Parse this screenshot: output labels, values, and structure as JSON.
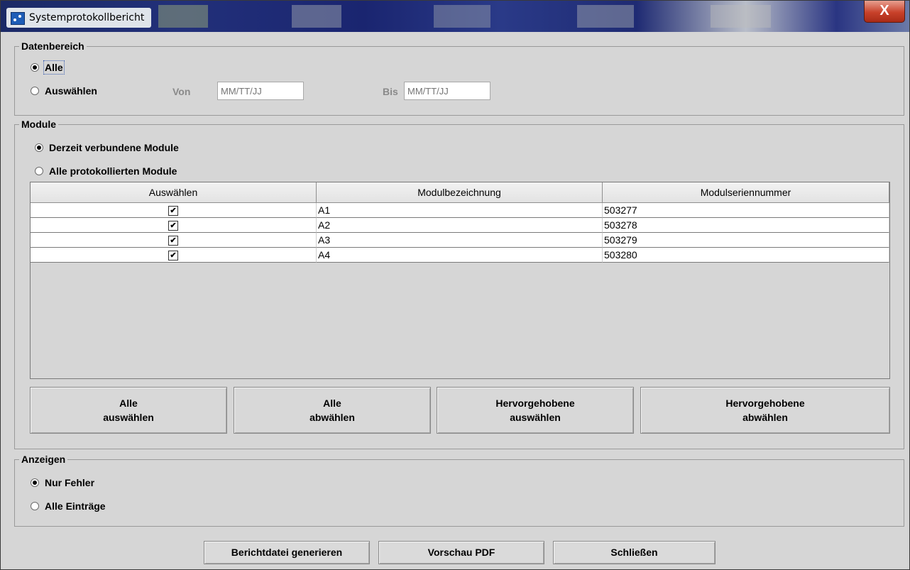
{
  "window": {
    "title": "Systemprotokollbericht",
    "close_glyph": "X"
  },
  "datenbereich": {
    "title": "Datenbereich",
    "options": [
      "Alle",
      "Auswählen"
    ],
    "selected": "Alle",
    "von_label": "Von",
    "von_placeholder": "MM/TT/JJ",
    "bis_label": "Bis",
    "bis_placeholder": "MM/TT/JJ"
  },
  "module": {
    "title": "Module",
    "options": [
      "Derzeit verbundene Module",
      "Alle protokollierten Module"
    ],
    "selected": "Derzeit verbundene Module",
    "table": {
      "headers": [
        "Auswählen",
        "Modulbezeichnung",
        "Modulseriennummer"
      ],
      "rows": [
        {
          "checked": true,
          "name": "A1",
          "serial": "503277"
        },
        {
          "checked": true,
          "name": "A2",
          "serial": "503278"
        },
        {
          "checked": true,
          "name": "A3",
          "serial": "503279"
        },
        {
          "checked": true,
          "name": "A4",
          "serial": "503280"
        }
      ]
    },
    "buttons": [
      {
        "line1": "Alle",
        "line2": "auswählen"
      },
      {
        "line1": "Alle",
        "line2": "abwählen"
      },
      {
        "line1": "Hervorgehobene",
        "line2": "auswählen"
      },
      {
        "line1": "Hervorgehobene",
        "line2": "abwählen"
      }
    ]
  },
  "anzeigen": {
    "title": "Anzeigen",
    "options": [
      "Nur Fehler",
      "Alle Einträge"
    ],
    "selected": "Nur Fehler"
  },
  "footer": {
    "generate": "Berichtdatei generieren",
    "preview": "Vorschau PDF",
    "close": "Schließen"
  },
  "icons": {
    "app": "app-icon",
    "close": "close-icon",
    "check": "checkmark-icon",
    "check_glyph": "✔"
  }
}
